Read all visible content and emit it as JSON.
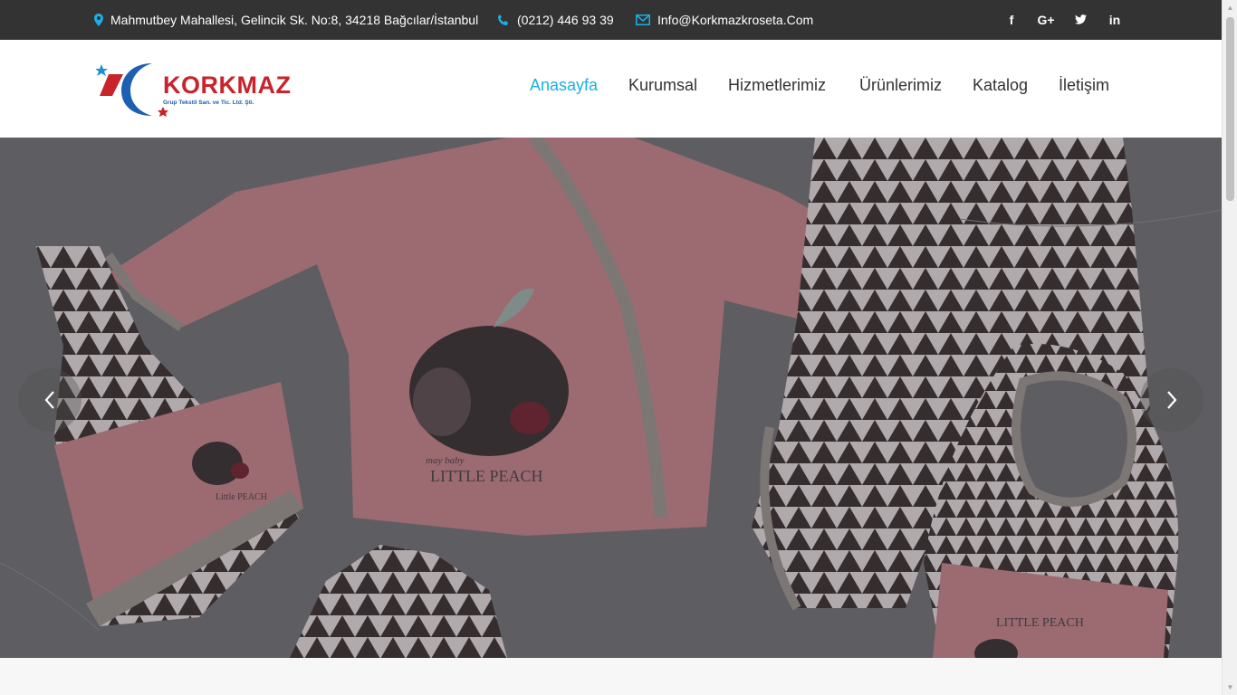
{
  "topbar": {
    "address": "Mahmutbey Mahallesi, Gelincik Sk. No:8, 34218 Bağcılar/İstanbul",
    "phone": "(0212) 446 93 39",
    "email": "Info@Korkmazkroseta.Com",
    "social": [
      {
        "name": "facebook",
        "glyph": "f"
      },
      {
        "name": "google-plus",
        "glyph": "G+"
      },
      {
        "name": "twitter",
        "glyph": "t"
      },
      {
        "name": "linkedin",
        "glyph": "in"
      }
    ]
  },
  "logo": {
    "word": "KORKMAZ",
    "subtitle": "Grup Tekstil San. ve Tic. Ltd. Şti."
  },
  "nav": {
    "items": [
      {
        "label": "Anasayfa",
        "active": true
      },
      {
        "label": "Kurumsal",
        "active": false
      },
      {
        "label": "Hizmetlerimiz",
        "active": false
      },
      {
        "label": "Ürünlerimiz",
        "active": false
      },
      {
        "label": "Katalog",
        "active": false
      },
      {
        "label": "İletişim",
        "active": false
      }
    ]
  },
  "hero": {
    "print_text_main": "LITTLE PEACH",
    "print_text_small": "may baby",
    "hat_print_text": "Little PEACH",
    "bib_print_text": "LITTLE PEACH"
  },
  "colors": {
    "accent": "#1ab0e6",
    "topbar_bg": "#333333",
    "brand_red": "#c7242b",
    "brand_blue": "#1d5fb0"
  }
}
